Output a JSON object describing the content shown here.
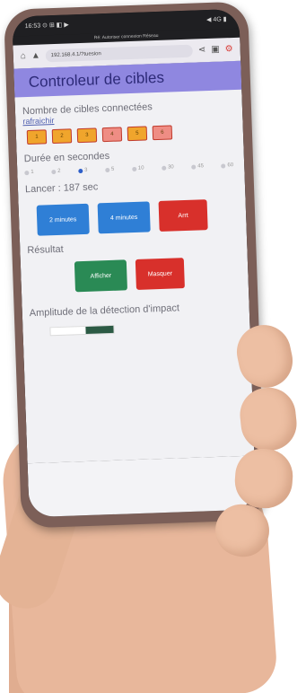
{
  "status_bar": {
    "time": "16:53 ⊙ ⊞ ◧ ▶",
    "indicators": "◀ 4G ▮"
  },
  "notification": {
    "text": "Ré: Autoriser connexion Réseau"
  },
  "browser": {
    "url": "192.168.4.1/?tuesion",
    "icons": [
      "home-icon",
      "warning-icon",
      "share-icon",
      "tabs-icon",
      "menu-icon"
    ]
  },
  "app": {
    "title": "Controleur de cibles",
    "connected_label": "Nombre de cibles connectées",
    "refresh_link": "rafraichir",
    "targets": [
      {
        "label": "1",
        "color": "#f0a52c"
      },
      {
        "label": "2",
        "color": "#f0a52c"
      },
      {
        "label": "3",
        "color": "#f0a52c"
      },
      {
        "label": "4",
        "color": "#ef8d84"
      },
      {
        "label": "5",
        "color": "#f0a52c"
      },
      {
        "label": "6",
        "color": "#ef8d84"
      }
    ],
    "duration_label": "Durée en secondes",
    "duration_options": [
      "1",
      "2",
      "3",
      "5",
      "10",
      "30",
      "45",
      "60"
    ],
    "duration_selected_index": 2,
    "launch_text": "Lancer : 187 sec",
    "btn_2min": "2 minutes",
    "btn_4min": "4 minutes",
    "btn_stop": "Arrt",
    "result_label": "Résultat",
    "btn_show": "Afficher",
    "btn_hide": "Masquer",
    "impact_label": "Amplitude de la détection d'impact",
    "impact_level": 0.45
  },
  "colors": {
    "header_bg": "#8f87e0",
    "blue": "#2f7fd6",
    "red": "#d8302b",
    "green": "#2a8a55"
  }
}
